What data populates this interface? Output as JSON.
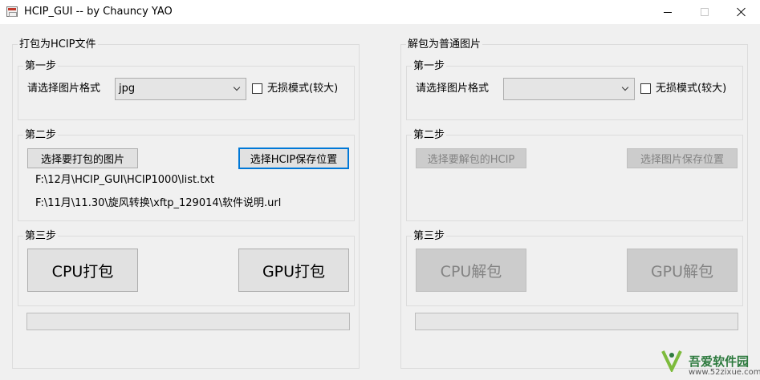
{
  "window": {
    "title": "HCIP_GUI -- by Chauncy YAO"
  },
  "pack": {
    "title": "打包为HCIP文件",
    "step1": {
      "title": "第一步",
      "format_label": "请选择图片格式",
      "format_value": "jpg",
      "lossless_label": "无损模式(较大)",
      "lossless_checked": false
    },
    "step2": {
      "title": "第二步",
      "select_images_button": "选择要打包的图片",
      "select_save_button": "选择HCIP保存位置",
      "images_path": "F:\\12月\\HCIP_GUI\\HCIP1000\\list.txt",
      "save_path": "F:\\11月\\11.30\\旋风转换\\xftp_129014\\软件说明.url"
    },
    "step3": {
      "title": "第三步",
      "cpu_button": "CPU打包",
      "gpu_button": "GPU打包"
    },
    "progress": 0
  },
  "unpack": {
    "title": "解包为普通图片",
    "step1": {
      "title": "第一步",
      "format_label": "请选择图片格式",
      "format_value": "",
      "lossless_label": "无损模式(较大)",
      "lossless_checked": false
    },
    "step2": {
      "title": "第二步",
      "select_hcip_button": "选择要解包的HCIP",
      "select_save_button": "选择图片保存位置"
    },
    "step3": {
      "title": "第三步",
      "cpu_button": "CPU解包",
      "gpu_button": "GPU解包"
    },
    "progress": 0
  },
  "watermark": {
    "name": "吾爱软件园",
    "url": "www.52zixue.com"
  }
}
